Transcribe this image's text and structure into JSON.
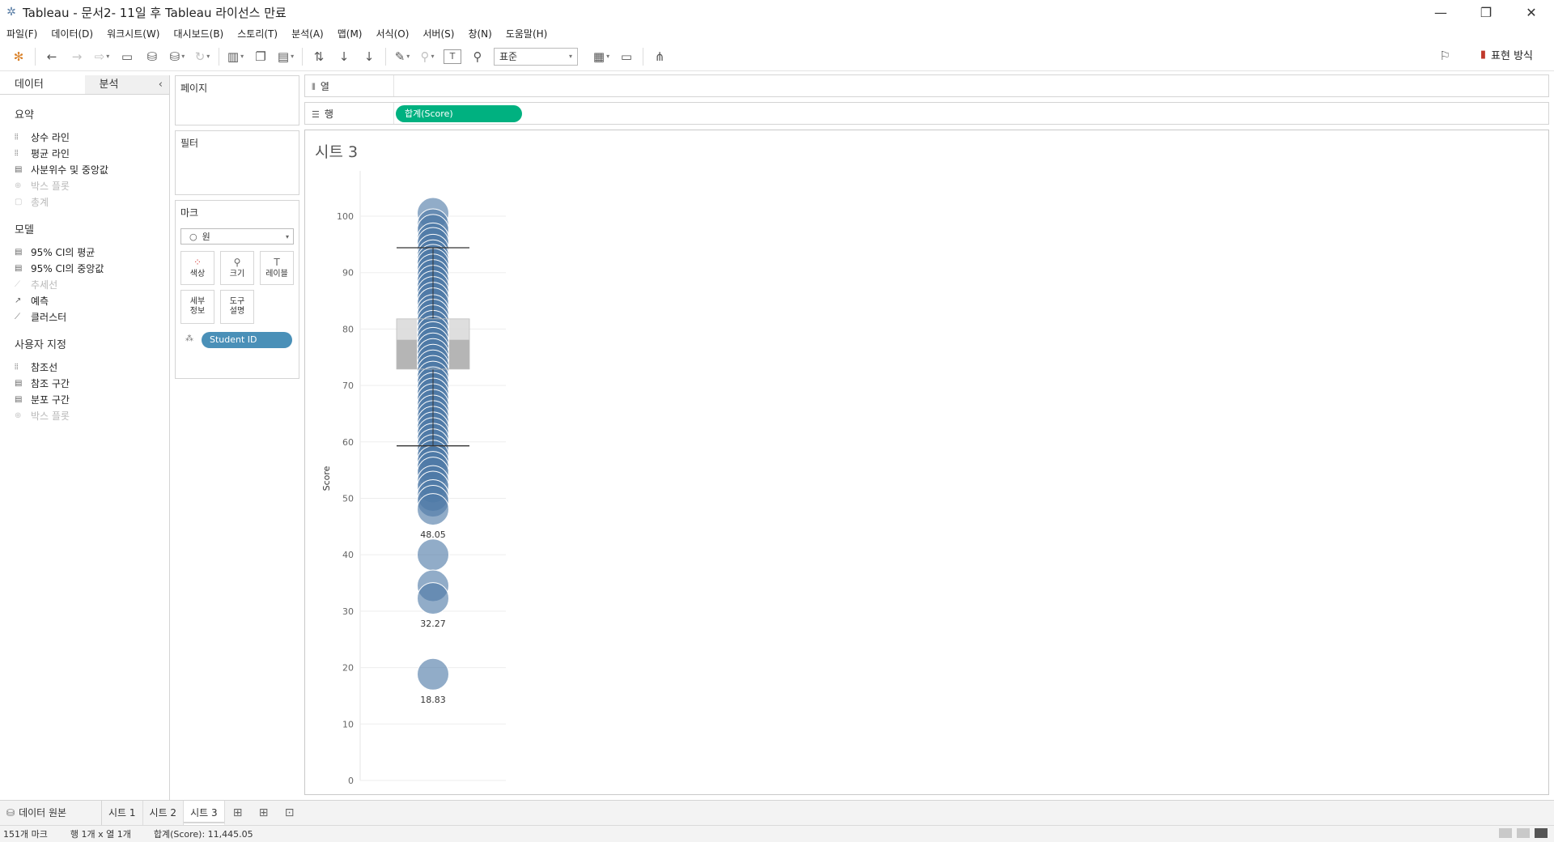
{
  "window": {
    "title": "Tableau - 문서2- 11일 후 Tableau 라이선스 만료",
    "controls": {
      "minimize": "—",
      "restore": "❐",
      "close": "✕"
    }
  },
  "menu": [
    "파일(F)",
    "데이터(D)",
    "워크시트(W)",
    "대시보드(B)",
    "스토리(T)",
    "분석(A)",
    "맵(M)",
    "서식(O)",
    "서버(S)",
    "창(N)",
    "도움말(H)"
  ],
  "toolbar": {
    "fit_value": "표준",
    "show_me_label": "표현 방식"
  },
  "left_pane": {
    "tabs": {
      "data": "데이터",
      "analysis": "분석"
    },
    "sections": [
      {
        "heading": "요약",
        "items": [
          {
            "label": "상수 라인",
            "enabled": true
          },
          {
            "label": "평균 라인",
            "enabled": true
          },
          {
            "label": "사분위수 및 중앙값",
            "enabled": true
          },
          {
            "label": "박스 플롯",
            "enabled": false
          },
          {
            "label": "총계",
            "enabled": false
          }
        ]
      },
      {
        "heading": "모델",
        "items": [
          {
            "label": "95% CI의 평균",
            "enabled": true
          },
          {
            "label": "95% CI의 중앙값",
            "enabled": true
          },
          {
            "label": "추세선",
            "enabled": false
          },
          {
            "label": "예측",
            "enabled": true
          },
          {
            "label": "클러스터",
            "enabled": true
          }
        ]
      },
      {
        "heading": "사용자 지정",
        "items": [
          {
            "label": "참조선",
            "enabled": true
          },
          {
            "label": "참조 구간",
            "enabled": true
          },
          {
            "label": "분포 구간",
            "enabled": true
          },
          {
            "label": "박스 플롯",
            "enabled": false
          }
        ]
      }
    ]
  },
  "cards": {
    "pages_title": "페이지",
    "filters_title": "필터",
    "marks_title": "마크",
    "mark_type": "원",
    "buttons": {
      "color": "색상",
      "size": "크기",
      "label": "레이블",
      "detail": "세부\n정보",
      "tooltip": "도구\n설명"
    },
    "detail_pill": "Student ID"
  },
  "shelves": {
    "columns_label": "열",
    "rows_label": "행",
    "rows_pill": "합계(Score)"
  },
  "sheet": {
    "title": "시트 3"
  },
  "chart_data": {
    "type": "scatter",
    "subtype": "box-plot-with-circles",
    "ylabel": "Score",
    "xlabel": "",
    "ylim": [
      0,
      100
    ],
    "yticks": [
      0,
      10,
      20,
      30,
      40,
      50,
      60,
      70,
      80,
      90,
      100
    ],
    "points": [
      100.5,
      98.5,
      97.5,
      96,
      95.2,
      94,
      93,
      92.2,
      91.5,
      90.5,
      89.5,
      88.5,
      87.5,
      86.5,
      85.5,
      84.5,
      83.3,
      82.5,
      81.5,
      80.5,
      79.5,
      78.5,
      77.5,
      76.5,
      75.5,
      74.5,
      73.5,
      72.5,
      71.5,
      70.5,
      69.5,
      68.5,
      67.5,
      66.5,
      65.5,
      64.5,
      63.5,
      62.5,
      61.5,
      60.5,
      59.5,
      58.5,
      57.5,
      56.5,
      55.5,
      54.5,
      53,
      52,
      50.5,
      49.5,
      48.05,
      40,
      34.5,
      32.27,
      18.83
    ],
    "box": {
      "lower_whisker": 59.3,
      "q1": 72.9,
      "median": 78.1,
      "q3": 81.8,
      "upper_whisker": 94.4
    },
    "labels": [
      {
        "value": 48.05,
        "text": "48.05"
      },
      {
        "value": 32.27,
        "text": "32.27"
      },
      {
        "value": 18.83,
        "text": "18.83"
      }
    ],
    "colors": {
      "mark": "#4e79a7",
      "box_upper": "#d8d8d8",
      "box_lower": "#a8a8a8",
      "whisker": "#333333"
    },
    "grid": true
  },
  "bottom_tabs": {
    "data_source": "데이터 원본",
    "sheets": [
      "시트 1",
      "시트 2",
      "시트 3"
    ],
    "active": "시트 3"
  },
  "status": {
    "marks": "151개 마크",
    "rows_cols": "행 1개 x 열 1개",
    "sum": "합계(Score): 11,445.05"
  }
}
